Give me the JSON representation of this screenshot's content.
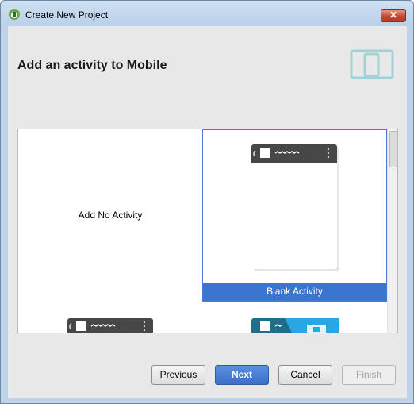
{
  "window": {
    "title": "Create New Project",
    "close_label": "✕"
  },
  "header": {
    "title": "Add an activity to Mobile"
  },
  "gallery": {
    "tiles": [
      {
        "label": "Add No Activity"
      },
      {
        "label": "Blank Activity"
      }
    ]
  },
  "footer": {
    "previous_prefix": "",
    "previous_mnemonic": "P",
    "previous_rest": "revious",
    "next_mnemonic": "N",
    "next_rest": "ext",
    "cancel_label": "Cancel",
    "finish_label": "Finish"
  },
  "colors": {
    "accent": "#3a75d0",
    "device_icon": "#9fd3d6",
    "app_bar": "#474747"
  }
}
